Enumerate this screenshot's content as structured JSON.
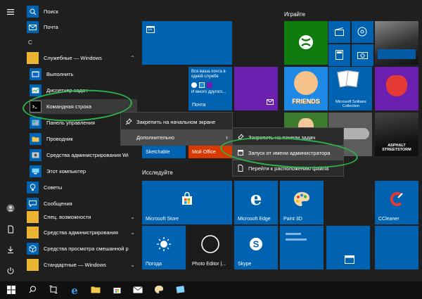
{
  "applist": {
    "search_label": "Поиск",
    "mail_label": "Почта",
    "letter_c": "С",
    "folder_label": "Служебные — Windows",
    "run_label": "Выполнить",
    "taskmgr_label": "Диспетчер задач",
    "cmd_label": "Командная строка",
    "control_label": "Панель управления",
    "explorer_label": "Проводник",
    "admin_tools_label": "Средства администрирования Wi",
    "this_pc_label": "Этот компьютер",
    "tips_label": "Советы",
    "messages_label": "Сообщения",
    "accessibility_label": "Спец. возможности",
    "admin_tools2_label": "Средства администрирования",
    "mixed_reality_label": "Средства просмотра смешанной р",
    "standard_label": "Стандартные — Windows"
  },
  "groups": {
    "play": "Играйте",
    "explore": "Исследуйте"
  },
  "tiles": {
    "mail_tile_line1": "Вся ваша почта в одной службе",
    "mail_tile_more": "И много другого...",
    "mail_tile_label": "Почта",
    "sketchable": "Sketchable",
    "myoffice": "Мой Office",
    "store": "Microsoft Store",
    "edge": "Microsoft Edge",
    "paint3d": "Paint 3D",
    "ccleaner": "CCleaner",
    "weather": "Погода",
    "photo_editor": "Photo Editor |...",
    "skype": "Skype",
    "solitaire": "Microsoft Solitaire Collection",
    "friends": "FRIENDS",
    "asphalt": "ASPHALT STREETSTORM"
  },
  "menu1": {
    "pin": "Закрепить на начальном экране",
    "more": "Дополнительно"
  },
  "menu2": {
    "pin_taskbar": "Закрепить на панели задач",
    "run_admin": "Запуск от имени администратора",
    "open_location": "Перейти к расположению файла"
  },
  "colors": {
    "tile_blue": "#0063b1",
    "highlight_green": "#2eb34a",
    "accent_purple": "#6b1fb1",
    "myoffice_red": "#d83b01"
  }
}
